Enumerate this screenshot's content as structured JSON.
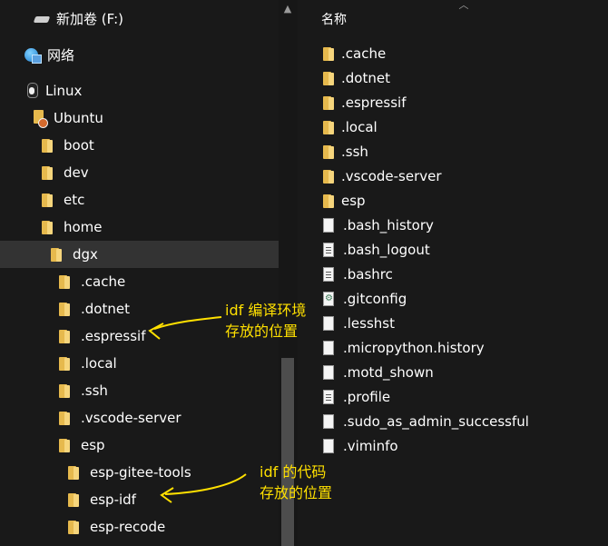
{
  "nav": {
    "drive": "新加卷 (F:)",
    "network": "网络",
    "linux": "Linux",
    "ubuntu": "Ubuntu",
    "ubuntu_folders": [
      "boot",
      "dev",
      "etc",
      "home"
    ],
    "user": "dgx",
    "user_folders": [
      ".cache",
      ".dotnet",
      ".espressif",
      ".local",
      ".ssh",
      ".vscode-server",
      "esp"
    ],
    "esp_folders": [
      "esp-gitee-tools",
      "esp-idf",
      "esp-recode"
    ]
  },
  "main": {
    "column_header": "名称",
    "folders": [
      ".cache",
      ".dotnet",
      ".espressif",
      ".local",
      ".ssh",
      ".vscode-server",
      "esp"
    ],
    "files": [
      {
        "name": ".bash_history",
        "icon": "document-icon"
      },
      {
        "name": ".bash_logout",
        "icon": "text-document-icon"
      },
      {
        "name": ".bashrc",
        "icon": "text-document-icon"
      },
      {
        "name": ".gitconfig",
        "icon": "config-document-icon"
      },
      {
        "name": ".lesshst",
        "icon": "document-icon"
      },
      {
        "name": ".micropython.history",
        "icon": "document-icon"
      },
      {
        "name": ".motd_shown",
        "icon": "document-icon"
      },
      {
        "name": ".profile",
        "icon": "text-document-icon"
      },
      {
        "name": ".sudo_as_admin_successful",
        "icon": "document-icon"
      },
      {
        "name": ".viminfo",
        "icon": "document-icon"
      }
    ]
  },
  "annotations": {
    "espressif_note": [
      "idf 编译环境",
      "存放的位置"
    ],
    "esp_idf_note": [
      "idf 的代码",
      "存放的位置"
    ]
  },
  "colors": {
    "background": "#191919",
    "selected_row": "#333333",
    "annotation": "#ffe000",
    "folder": "#f6d57c"
  }
}
